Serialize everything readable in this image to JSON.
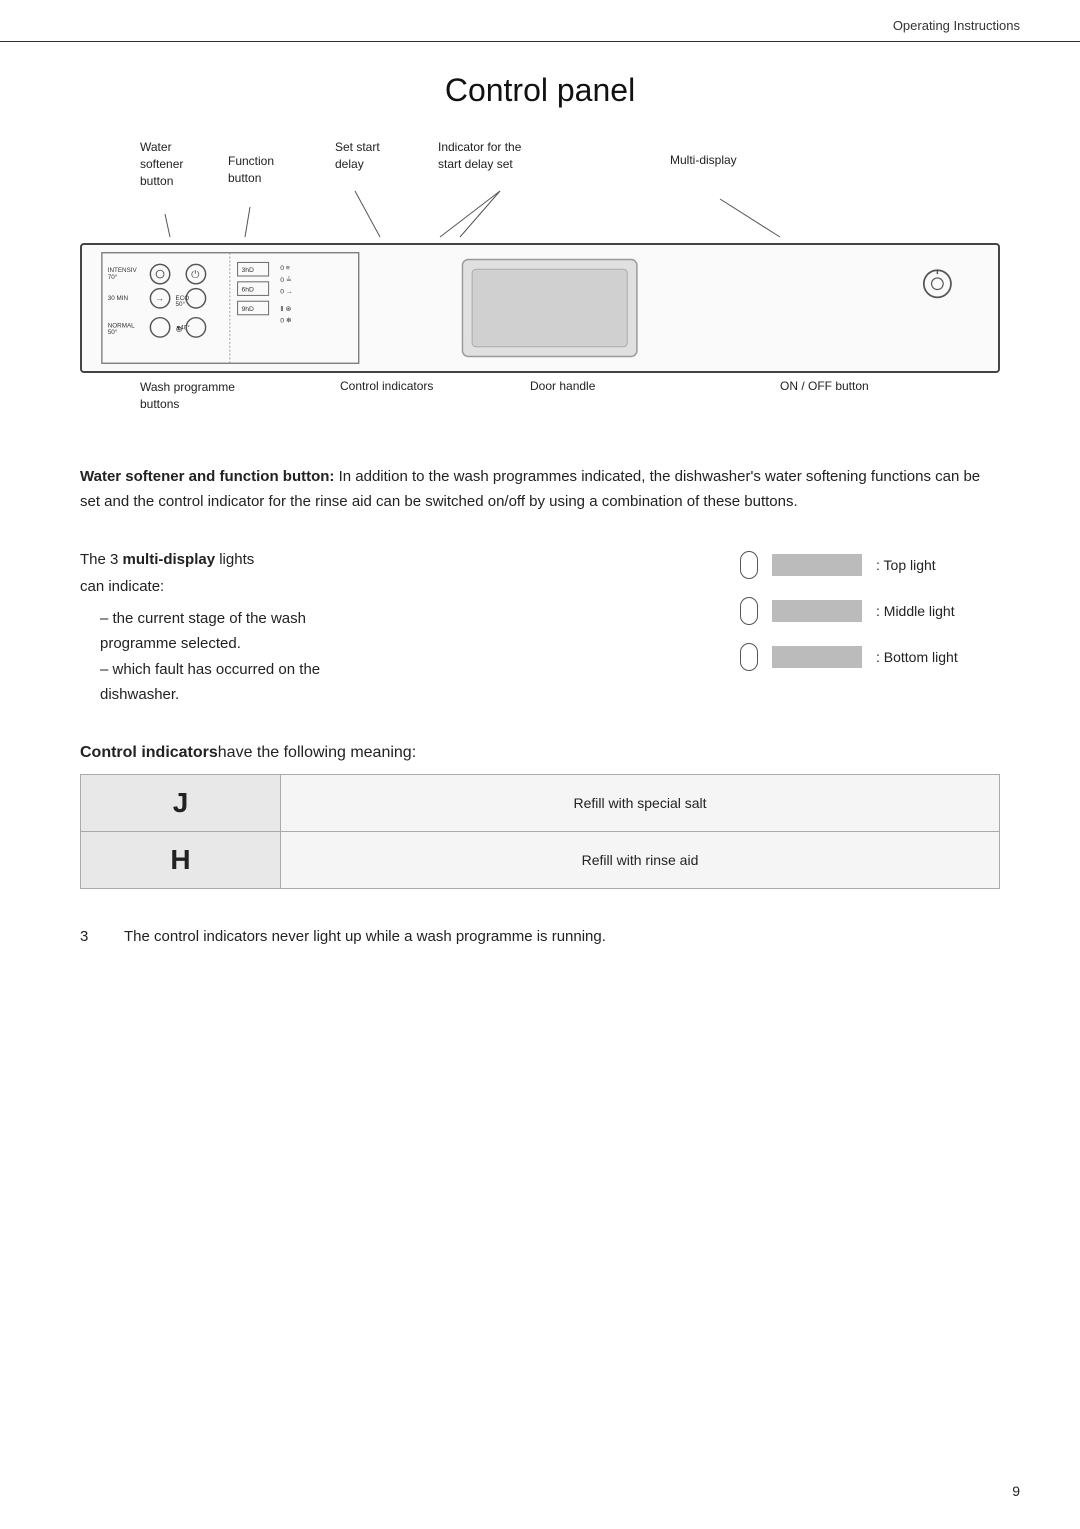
{
  "header": {
    "title": "Operating Instructions"
  },
  "page": {
    "number": "9"
  },
  "content": {
    "page_title": "Control panel",
    "labels": {
      "water_softener": [
        "Water",
        "softener",
        "button"
      ],
      "function_button": [
        "Function",
        "button"
      ],
      "set_start_delay": [
        "Set start",
        "delay"
      ],
      "indicator_for": [
        "Indicator for the",
        "start delay set"
      ],
      "multi_display": "Multi-display",
      "wash_programme": [
        "Wash programme",
        "buttons"
      ],
      "control_indicators": "Control indicators",
      "door_handle": "Door handle",
      "on_off_button": "ON / OFF button"
    },
    "body_text": {
      "bold_start": "Water softener and function button:",
      "text": " In addition to the wash programmes indicated, the dishwasher's water softening functions can be set and the control indicator for the rinse aid can be switched on/off by using a combination of these buttons."
    },
    "multi_display": {
      "intro_bold": "multi-display",
      "intro_prefix": "The 3 ",
      "intro_suffix": " lights",
      "can_indicate": "can indicate:",
      "bullets": [
        "the current stage of the wash programme selected.",
        "which fault has occurred on the dishwasher."
      ],
      "lights": [
        {
          "label": ": Top light"
        },
        {
          "label": ": Middle light"
        },
        {
          "label": ": Bottom light"
        }
      ]
    },
    "control_indicators_section": {
      "prefix": "Control indicators",
      "suffix": "have the following meaning:",
      "rows": [
        {
          "symbol": "J",
          "description": "Refill with special salt"
        },
        {
          "symbol": "H",
          "description": "Refill with rinse aid"
        }
      ]
    },
    "note": {
      "number": "3",
      "text": "The control indicators never light up while a wash programme is running."
    }
  }
}
